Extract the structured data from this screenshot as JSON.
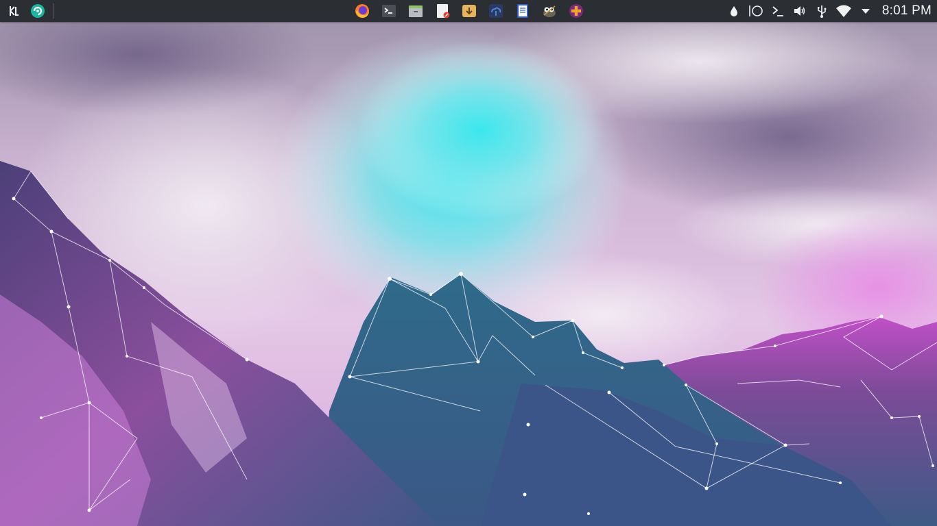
{
  "panel": {
    "launcher_icon": "kde-logo-icon",
    "pinned_icon": "software-center-icon"
  },
  "taskbar": {
    "tasks": [
      {
        "name": "firefox",
        "icon": "firefox-icon"
      },
      {
        "name": "terminal",
        "icon": "terminal-icon"
      },
      {
        "name": "file-manager",
        "icon": "file-manager-icon"
      },
      {
        "name": "text-editor",
        "icon": "document-edit-icon"
      },
      {
        "name": "downloader",
        "icon": "download-manager-icon"
      },
      {
        "name": "cloud-app",
        "icon": "cloud-app-icon"
      },
      {
        "name": "document-writer",
        "icon": "writer-document-icon"
      },
      {
        "name": "gimp",
        "icon": "gimp-icon"
      },
      {
        "name": "media-app",
        "icon": "plus-badge-icon"
      }
    ]
  },
  "tray": {
    "icons": [
      "color-picker-icon",
      "activity-circle-icon",
      "terminal-prompt-icon",
      "volume-icon",
      "usb-icon",
      "wifi-icon",
      "expand-arrow-icon"
    ],
    "clock": "8:01 PM"
  },
  "colors": {
    "panel_bg": "#2b2e33",
    "sky_top": "#c9a9c6",
    "cloud_cyan": "#4fe3e8",
    "mountain_dark": "#3d5a85",
    "mountain_pink": "#c26ad1"
  }
}
